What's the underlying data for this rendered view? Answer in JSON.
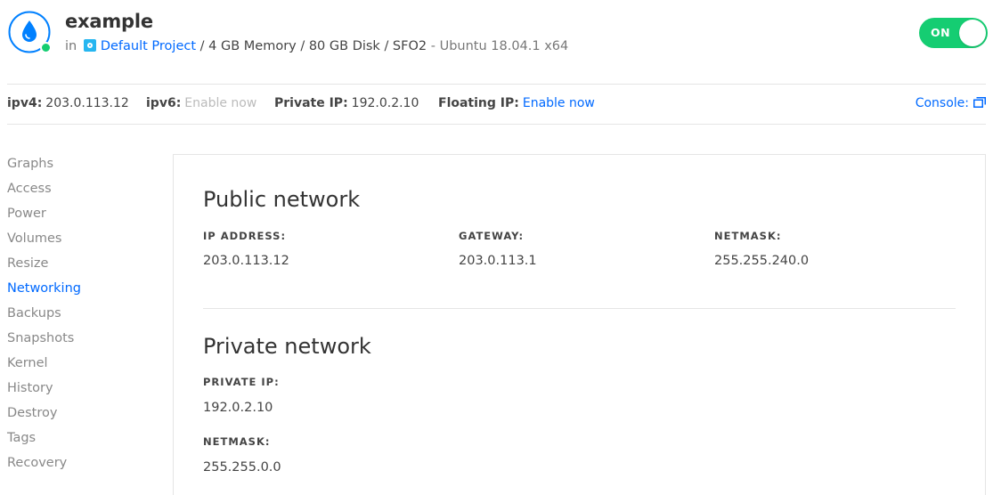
{
  "header": {
    "title": "example",
    "in_label": "in",
    "project_link": "Default Project",
    "specs": "/ 4 GB Memory / 80 GB Disk / SFO2",
    "image": "- Ubuntu 18.04.1 x64",
    "power_toggle_label": "ON",
    "power_state": "on"
  },
  "ipbar": {
    "ipv4_label": "ipv4:",
    "ipv4_value": "203.0.113.12",
    "ipv6_label": "ipv6:",
    "ipv6_value": "Enable now",
    "private_ip_label": "Private IP:",
    "private_ip_value": "192.0.2.10",
    "floating_ip_label": "Floating IP:",
    "floating_ip_value": "Enable now",
    "console_label": "Console:"
  },
  "sidebar": {
    "items": [
      {
        "label": "Graphs",
        "active": false
      },
      {
        "label": "Access",
        "active": false
      },
      {
        "label": "Power",
        "active": false
      },
      {
        "label": "Volumes",
        "active": false
      },
      {
        "label": "Resize",
        "active": false
      },
      {
        "label": "Networking",
        "active": true
      },
      {
        "label": "Backups",
        "active": false
      },
      {
        "label": "Snapshots",
        "active": false
      },
      {
        "label": "Kernel",
        "active": false
      },
      {
        "label": "History",
        "active": false
      },
      {
        "label": "Destroy",
        "active": false
      },
      {
        "label": "Tags",
        "active": false
      },
      {
        "label": "Recovery",
        "active": false
      }
    ]
  },
  "public_network": {
    "title": "Public network",
    "ip_label": "IP ADDRESS:",
    "ip_value": "203.0.113.12",
    "gateway_label": "GATEWAY:",
    "gateway_value": "203.0.113.1",
    "netmask_label": "NETMASK:",
    "netmask_value": "255.255.240.0"
  },
  "private_network": {
    "title": "Private network",
    "ip_label": "PRIVATE IP:",
    "ip_value": "192.0.2.10",
    "netmask_label": "NETMASK:",
    "netmask_value": "255.255.0.0"
  },
  "colors": {
    "accent": "#0069ff",
    "status_on": "#15cd72",
    "droplet_blue": "#0080ff"
  },
  "icons": {
    "droplet": "droplet-icon",
    "project": "project-icon",
    "console": "external-window-icon"
  }
}
